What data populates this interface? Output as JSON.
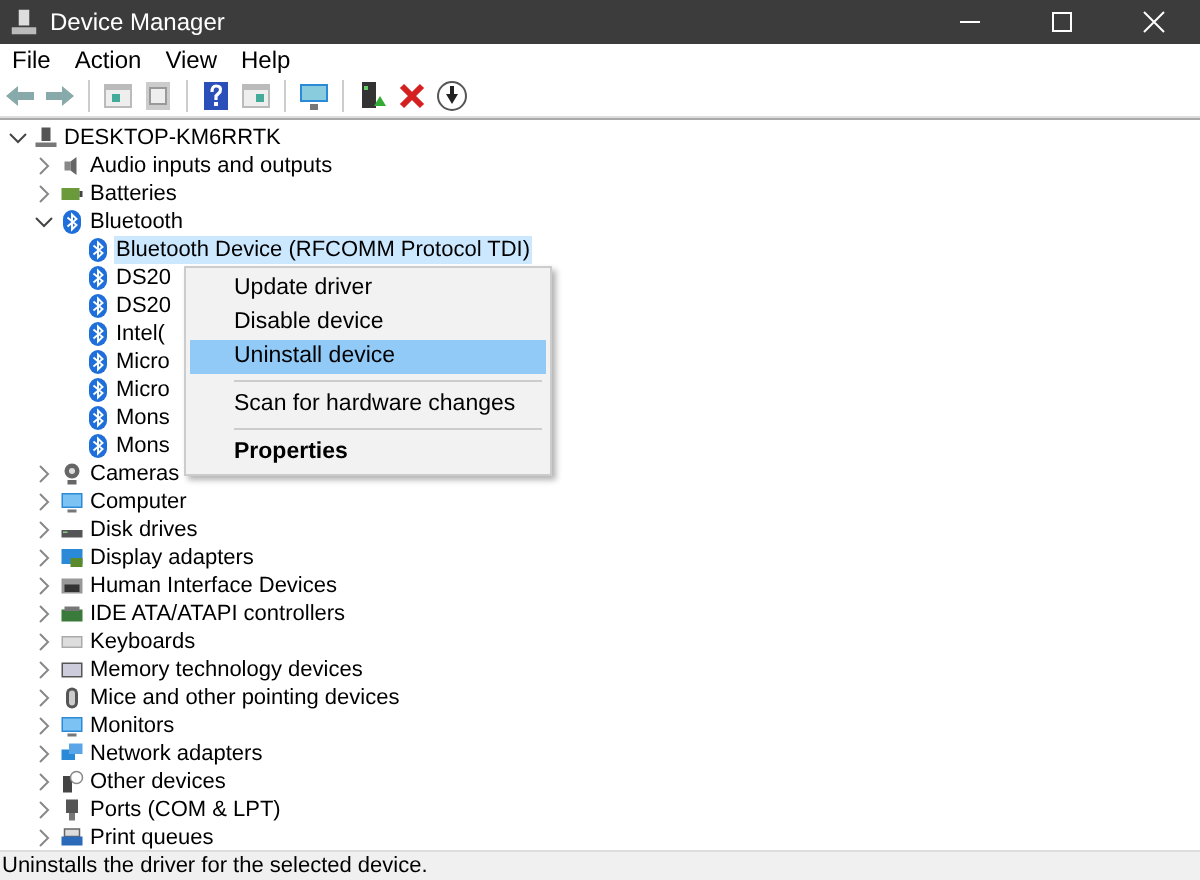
{
  "window": {
    "title": "Device Manager"
  },
  "menu_bar": [
    "File",
    "Action",
    "View",
    "Help"
  ],
  "toolbar": [
    {
      "kind": "back"
    },
    {
      "kind": "forward"
    },
    {
      "kind": "sep"
    },
    {
      "kind": "tree"
    },
    {
      "kind": "props"
    },
    {
      "kind": "sep"
    },
    {
      "kind": "help"
    },
    {
      "kind": "pane"
    },
    {
      "kind": "sep"
    },
    {
      "kind": "scan"
    },
    {
      "kind": "sep"
    },
    {
      "kind": "update"
    },
    {
      "kind": "uninstall"
    },
    {
      "kind": "download"
    }
  ],
  "tree": [
    {
      "label": "DESKTOP-KM6RRTK",
      "kind": "computer",
      "expanded": true,
      "selected": false,
      "children": [
        {
          "label": "Audio inputs and outputs",
          "kind": "audio",
          "expanded": false,
          "selected": false
        },
        {
          "label": "Batteries",
          "kind": "battery",
          "expanded": false,
          "selected": false
        },
        {
          "label": "Bluetooth",
          "kind": "bluetooth",
          "expanded": true,
          "selected": false,
          "children": [
            {
              "label": "Bluetooth Device (RFCOMM Protocol TDI)",
              "kind": "bluetooth",
              "selected": true
            },
            {
              "label": "DS20",
              "kind": "bluetooth",
              "selected": false
            },
            {
              "label": "DS20",
              "kind": "bluetooth",
              "selected": false
            },
            {
              "label": "Intel(",
              "kind": "bluetooth",
              "selected": false
            },
            {
              "label": "Micro",
              "kind": "bluetooth",
              "selected": false
            },
            {
              "label": "Micro",
              "kind": "bluetooth",
              "selected": false
            },
            {
              "label": "Mons",
              "kind": "bluetooth",
              "selected": false
            },
            {
              "label": "Mons",
              "kind": "bluetooth",
              "selected": false
            }
          ]
        },
        {
          "label": "Cameras",
          "kind": "camera",
          "expanded": false,
          "selected": false
        },
        {
          "label": "Computer",
          "kind": "monitor",
          "expanded": false,
          "selected": false
        },
        {
          "label": "Disk drives",
          "kind": "disk",
          "expanded": false,
          "selected": false
        },
        {
          "label": "Display adapters",
          "kind": "display",
          "expanded": false,
          "selected": false
        },
        {
          "label": "Human Interface Devices",
          "kind": "hid",
          "expanded": false,
          "selected": false
        },
        {
          "label": "IDE ATA/ATAPI controllers",
          "kind": "ide",
          "expanded": false,
          "selected": false
        },
        {
          "label": "Keyboards",
          "kind": "keyboard",
          "expanded": false,
          "selected": false
        },
        {
          "label": "Memory technology devices",
          "kind": "memory",
          "expanded": false,
          "selected": false
        },
        {
          "label": "Mice and other pointing devices",
          "kind": "mouse",
          "expanded": false,
          "selected": false
        },
        {
          "label": "Monitors",
          "kind": "monitor",
          "expanded": false,
          "selected": false
        },
        {
          "label": "Network adapters",
          "kind": "network",
          "expanded": false,
          "selected": false
        },
        {
          "label": "Other devices",
          "kind": "other",
          "expanded": false,
          "selected": false
        },
        {
          "label": "Ports (COM & LPT)",
          "kind": "port",
          "expanded": false,
          "selected": false
        },
        {
          "label": "Print queues",
          "kind": "printer",
          "expanded": false,
          "selected": false
        }
      ]
    }
  ],
  "context_menu": [
    {
      "kind": "item",
      "label": "Update driver",
      "selected": false
    },
    {
      "kind": "item",
      "label": "Disable device",
      "selected": false
    },
    {
      "kind": "item",
      "label": "Uninstall device",
      "selected": true
    },
    {
      "kind": "separator"
    },
    {
      "kind": "item",
      "label": "Scan for hardware changes",
      "selected": false
    },
    {
      "kind": "separator"
    },
    {
      "kind": "default",
      "label": "Properties",
      "selected": false
    }
  ],
  "status_bar": "Uninstalls the driver for the selected device."
}
